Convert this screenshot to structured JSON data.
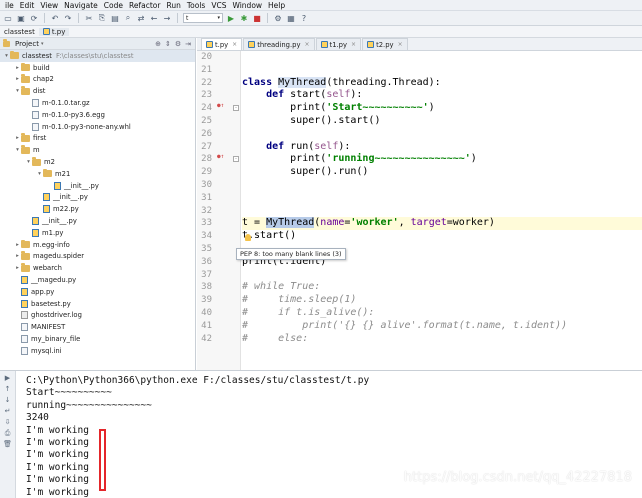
{
  "menu": [
    "ile",
    "Edit",
    "View",
    "Navigate",
    "Code",
    "Refactor",
    "Run",
    "Tools",
    "VCS",
    "Window",
    "Help"
  ],
  "toolbar": {
    "run_config_label": "t",
    "icons": [
      "folder-open-icon",
      "save-icon",
      "sync-icon",
      "back-icon",
      "forward-icon",
      "cut-icon",
      "copy-icon",
      "paste-icon",
      "find-icon",
      "replace-icon",
      "run-config-select",
      "run-icon",
      "debug-icon",
      "stop-icon",
      "settings-icon"
    ]
  },
  "navbar": {
    "project": "classtest",
    "file": "t.py"
  },
  "project_panel": {
    "title": "Project",
    "root": "classtest",
    "root_path": "F:\\classes\\stu\\classtest",
    "items": [
      {
        "label": "build",
        "type": "folder",
        "indent": 1,
        "arrow": "▸"
      },
      {
        "label": "chap2",
        "type": "folder",
        "indent": 1,
        "arrow": "▸"
      },
      {
        "label": "dist",
        "type": "folder",
        "indent": 1,
        "arrow": "▾"
      },
      {
        "label": "m-0.1.0.tar.gz",
        "type": "file",
        "indent": 2,
        "arrow": ""
      },
      {
        "label": "m-0.1.0-py3.6.egg",
        "type": "file",
        "indent": 2,
        "arrow": ""
      },
      {
        "label": "m-0.1.0-py3-none-any.whl",
        "type": "file",
        "indent": 2,
        "arrow": ""
      },
      {
        "label": "first",
        "type": "folder",
        "indent": 1,
        "arrow": "▸"
      },
      {
        "label": "m",
        "type": "folder",
        "indent": 1,
        "arrow": "▾"
      },
      {
        "label": "m2",
        "type": "folder",
        "indent": 2,
        "arrow": "▾"
      },
      {
        "label": "m21",
        "type": "folder",
        "indent": 3,
        "arrow": "▾"
      },
      {
        "label": "__init__.py",
        "type": "py",
        "indent": 4,
        "arrow": ""
      },
      {
        "label": "__init__.py",
        "type": "py",
        "indent": 3,
        "arrow": ""
      },
      {
        "label": "m22.py",
        "type": "py",
        "indent": 3,
        "arrow": ""
      },
      {
        "label": "__init__.py",
        "type": "py",
        "indent": 2,
        "arrow": ""
      },
      {
        "label": "m1.py",
        "type": "py",
        "indent": 2,
        "arrow": ""
      },
      {
        "label": "m.egg-info",
        "type": "folder",
        "indent": 1,
        "arrow": "▸"
      },
      {
        "label": "magedu.spider",
        "type": "folder",
        "indent": 1,
        "arrow": "▸"
      },
      {
        "label": "webarch",
        "type": "folder",
        "indent": 1,
        "arrow": "▸"
      },
      {
        "label": "__magedu.py",
        "type": "py",
        "indent": 1,
        "arrow": ""
      },
      {
        "label": "app.py",
        "type": "py",
        "indent": 1,
        "arrow": ""
      },
      {
        "label": "basetest.py",
        "type": "py",
        "indent": 1,
        "arrow": ""
      },
      {
        "label": "ghostdriver.log",
        "type": "log",
        "indent": 1,
        "arrow": ""
      },
      {
        "label": "MANIFEST",
        "type": "file",
        "indent": 1,
        "arrow": ""
      },
      {
        "label": "my_binary_file",
        "type": "file",
        "indent": 1,
        "arrow": ""
      },
      {
        "label": "mysql.ini",
        "type": "file",
        "indent": 1,
        "arrow": ""
      }
    ]
  },
  "tabs": [
    {
      "label": "t.py",
      "active": true
    },
    {
      "label": "threading.py",
      "active": false
    },
    {
      "label": "t1.py",
      "active": false
    },
    {
      "label": "t2.py",
      "active": false
    }
  ],
  "code": {
    "line_numbers": [
      "20",
      "21",
      "22",
      "23",
      "24",
      "25",
      "26",
      "27",
      "28",
      "29",
      "30",
      "31",
      "32",
      "33",
      "34",
      "35",
      "36",
      "37",
      "38",
      "39",
      "40",
      "41",
      "42"
    ],
    "tooltip": "PEP 8: too many blank lines (3)"
  },
  "console": {
    "lines": [
      "C:\\Python\\Python366\\python.exe F:/classes/stu/classtest/t.py",
      "Start~~~~~~~~~~",
      "running~~~~~~~~~~~~~~~",
      "3240",
      "I'm working",
      "I'm working",
      "I'm working",
      "I'm working",
      "I'm working",
      "I'm working"
    ]
  },
  "watermark": "https://blog.csdn.net/qq_42227818"
}
